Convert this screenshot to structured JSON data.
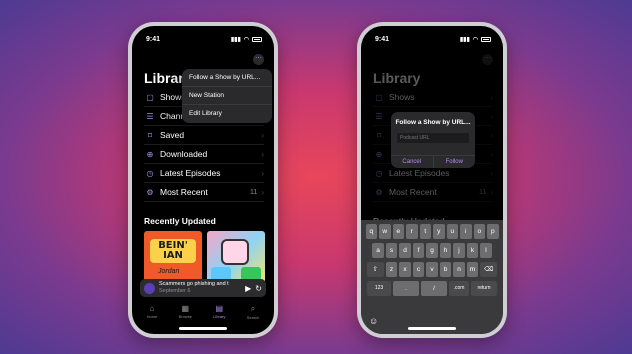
{
  "status": {
    "time": "9:41"
  },
  "left_phone": {
    "more_icon": "ellipsis-circle-icon",
    "title": "Library",
    "rows": [
      {
        "icon": "shows-icon",
        "label": "Shows",
        "count": ""
      },
      {
        "icon": "channels-icon",
        "label": "Channels",
        "count": ""
      },
      {
        "icon": "bookmark-icon",
        "label": "Saved",
        "count": ""
      },
      {
        "icon": "download-icon",
        "label": "Downloaded",
        "count": ""
      },
      {
        "icon": "clock-icon",
        "label": "Latest Episodes",
        "count": ""
      },
      {
        "icon": "gear-icon",
        "label": "Most Recent",
        "count": "11"
      }
    ],
    "menu": [
      "Follow a Show by URL...",
      "New Station",
      "Edit Library"
    ],
    "recently_updated": "Recently Updated",
    "tile1": {
      "line1": "BEIN'",
      "line2": "IAN",
      "line3": "Jordan"
    },
    "mini_player": {
      "title": "Scammers go phishing and t",
      "date": "September 6"
    },
    "tabs": [
      {
        "label": "Home",
        "icon": "home-icon"
      },
      {
        "label": "Browse",
        "icon": "grid-icon"
      },
      {
        "label": "Library",
        "icon": "library-icon"
      },
      {
        "label": "Search",
        "icon": "search-icon"
      }
    ]
  },
  "right_phone": {
    "title": "Library",
    "rows": [
      {
        "label": "Shows",
        "count": ""
      },
      {
        "label": "",
        "count": ""
      },
      {
        "label": "",
        "count": ""
      },
      {
        "label": "",
        "count": ""
      },
      {
        "label": "Latest Episodes",
        "count": ""
      },
      {
        "label": "Most Recent",
        "count": "11"
      }
    ],
    "recently_updated": "Recently Updated",
    "dialog": {
      "title": "Follow a Show by URL...",
      "placeholder": "Podcast URL",
      "cancel": "Cancel",
      "follow": "Follow"
    },
    "keyboard": {
      "row1": [
        "q",
        "w",
        "e",
        "r",
        "t",
        "y",
        "u",
        "i",
        "o",
        "p"
      ],
      "row2": [
        "a",
        "s",
        "d",
        "f",
        "g",
        "h",
        "j",
        "k",
        "l"
      ],
      "row3": [
        "z",
        "x",
        "c",
        "v",
        "b",
        "n",
        "m"
      ],
      "row4": [
        "123",
        ".",
        "/",
        ".com",
        "return"
      ]
    }
  }
}
